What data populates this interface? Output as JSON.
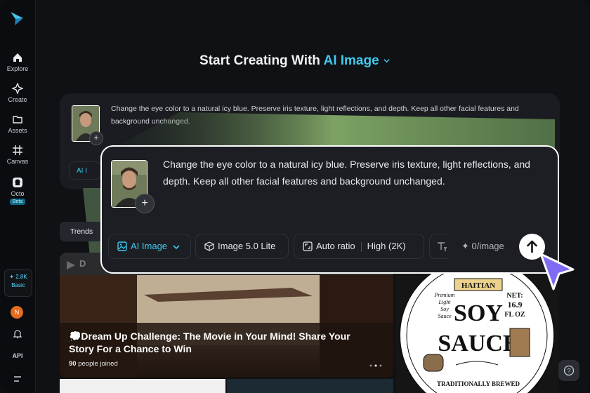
{
  "sidebar": {
    "items": [
      {
        "label": "Explore",
        "icon": "home-icon"
      },
      {
        "label": "Create",
        "icon": "sparkle-icon"
      },
      {
        "label": "Assets",
        "icon": "folder-icon"
      },
      {
        "label": "Canvas",
        "icon": "canvas-icon"
      },
      {
        "label": "Octo",
        "icon": "octo-icon",
        "badge": "Beta"
      }
    ],
    "credits": {
      "amount": "✦ 2.8K",
      "plan": "Basic"
    },
    "avatar_letter": "N",
    "api_label": "API"
  },
  "headline": {
    "prefix": "Start Creating With",
    "accent": "AI Image"
  },
  "background_card": {
    "prompt": "Change the eye color to a natural icy blue. Preserve iris texture, light reflections, and depth. Keep all other facial features and background unchanged.",
    "chip_label": "AI I"
  },
  "trends_tab": "Trends",
  "banner": {
    "title": "💭Dream Up Challenge: The Movie in Your Mind! Share Your Story For a Chance to Win",
    "participants": "90",
    "participants_suffix": "people joined"
  },
  "product_label": {
    "brand": "HAITIAN",
    "premium": "Premium",
    "light": "Light",
    "soy": "Soy",
    "sauce": "Sauce",
    "big1": "SOY",
    "big2": "SAUCE",
    "net": "NET:",
    "net_val": "16.9",
    "unit": "FL OZ",
    "footer": "TRADITIONALLY BREWED"
  },
  "prompt_panel": {
    "prompt": "Change the eye color to a natural icy blue. Preserve iris texture, light reflections, and depth. Keep all other facial features and background unchanged.",
    "mode_label": "AI Image",
    "model_label": "Image 5.0 Lite",
    "ratio_label": "Auto ratio",
    "quality_label": "High (2K)",
    "cost_label": "✦ 0/image"
  },
  "colors": {
    "accent": "#3ec9ee",
    "cursor": "#7f6cf5"
  }
}
